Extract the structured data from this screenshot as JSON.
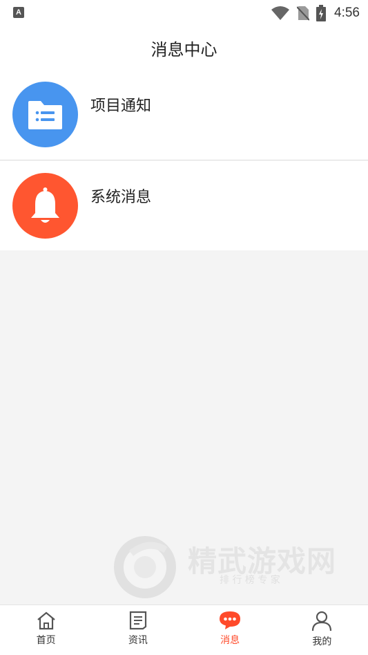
{
  "status_bar": {
    "time": "4:56",
    "notification_letter": "A"
  },
  "header": {
    "title": "消息中心"
  },
  "messages": [
    {
      "label": "项目通知",
      "icon": "folder-list-icon",
      "color": "#4895ef"
    },
    {
      "label": "系统消息",
      "icon": "bell-icon",
      "color": "#ff5630"
    }
  ],
  "watermark": {
    "brand": "精武游戏网",
    "slogan": "排 行 榜 专 家"
  },
  "tabbar": {
    "active_color": "#ff4a2a",
    "items": [
      {
        "label": "首页",
        "icon": "home-icon",
        "active": false
      },
      {
        "label": "资讯",
        "icon": "news-icon",
        "active": false
      },
      {
        "label": "消息",
        "icon": "chat-bubble-icon",
        "active": true
      },
      {
        "label": "我的",
        "icon": "user-icon",
        "active": false
      }
    ]
  }
}
